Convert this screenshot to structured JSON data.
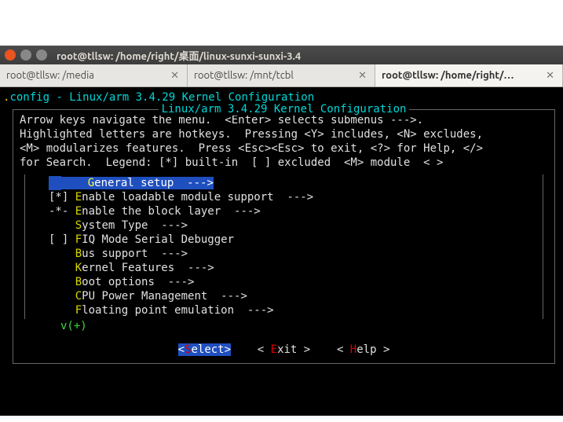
{
  "window": {
    "title": "root@tllsw: /home/right/桌面/linux-sunxi-sunxi-3.4"
  },
  "tabs": [
    {
      "label": "root@tllsw: /media",
      "active": false
    },
    {
      "label": "root@tllsw: /mnt/tcbl",
      "active": false
    },
    {
      "label": "root@tllsw: /home/right/…",
      "active": true
    }
  ],
  "config": {
    "heading_prefix": ".",
    "heading_rest": "config - Linux/arm 3.4.29 Kernel Configuration",
    "box_title": "Linux/arm 3.4.29 Kernel Configuration",
    "help_lines": [
      "Arrow keys navigate the menu.  <Enter> selects submenus --->.",
      "Highlighted letters are hotkeys.  Pressing <Y> includes, <N> excludes,",
      "<M> modularizes features.  Press <Esc><Esc> to exit, <?> for Help, </>",
      "for Search.  Legend: [*] built-in  [ ] excluded  <M> module  < >"
    ],
    "items": [
      {
        "prefix": "    ",
        "hot": "G",
        "rest": "eneral setup  --->",
        "selected": true
      },
      {
        "prefix": "[*] ",
        "hot": "E",
        "rest": "nable loadable module support  --->",
        "selected": false
      },
      {
        "prefix": "-*- ",
        "hot": "E",
        "rest": "nable the block layer  --->",
        "selected": false
      },
      {
        "prefix": "    ",
        "hot": "S",
        "rest": "ystem Type  --->",
        "selected": false
      },
      {
        "prefix": "[ ] ",
        "hot": "F",
        "rest": "IQ Mode Serial Debugger",
        "selected": false
      },
      {
        "prefix": "    ",
        "hot": "B",
        "rest": "us support  --->",
        "selected": false
      },
      {
        "prefix": "    ",
        "hot": "K",
        "rest": "ernel Features  --->",
        "selected": false
      },
      {
        "prefix": "    ",
        "hot": "B",
        "rest": "oot options  --->",
        "selected": false
      },
      {
        "prefix": "    ",
        "hot": "C",
        "rest": "PU Power Management  --->",
        "selected": false
      },
      {
        "prefix": "    ",
        "hot": "F",
        "rest": "loating point emulation  --->",
        "selected": false
      }
    ],
    "vplus": "v(+)",
    "buttons": {
      "select_open": "<",
      "select_hot": "S",
      "select_rest": "elect>",
      "exit_open": "< ",
      "exit_hot": "E",
      "exit_rest": "xit >",
      "help_open": "< ",
      "help_hot": "H",
      "help_rest": "elp >"
    }
  }
}
